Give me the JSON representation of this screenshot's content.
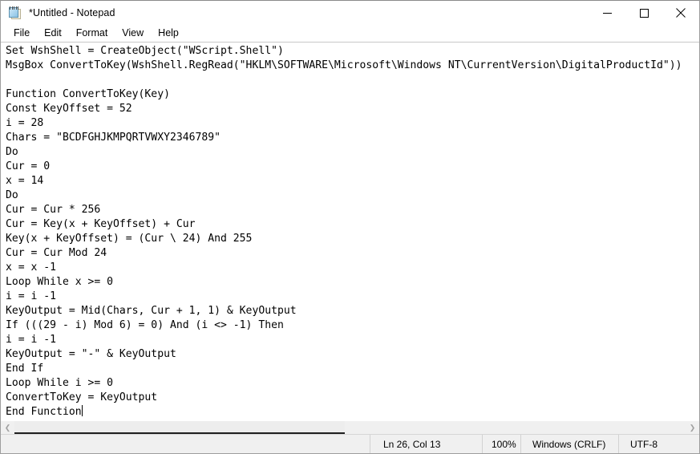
{
  "window": {
    "title": "*Untitled - Notepad",
    "icon": "notepad-icon",
    "controls": {
      "minimize": "minimize-icon",
      "maximize": "maximize-icon",
      "close": "close-icon"
    }
  },
  "menubar": {
    "items": [
      {
        "label": "File"
      },
      {
        "label": "Edit"
      },
      {
        "label": "Format"
      },
      {
        "label": "View"
      },
      {
        "label": "Help"
      }
    ]
  },
  "editor": {
    "lines": [
      "Set WshShell = CreateObject(\"WScript.Shell\")",
      "MsgBox ConvertToKey(WshShell.RegRead(\"HKLM\\SOFTWARE\\Microsoft\\Windows NT\\CurrentVersion\\DigitalProductId\"))",
      "",
      "Function ConvertToKey(Key)",
      "Const KeyOffset = 52",
      "i = 28",
      "Chars = \"BCDFGHJKMPQRTVWXY2346789\"",
      "Do",
      "Cur = 0",
      "x = 14",
      "Do",
      "Cur = Cur * 256",
      "Cur = Key(x + KeyOffset) + Cur",
      "Key(x + KeyOffset) = (Cur \\ 24) And 255",
      "Cur = Cur Mod 24",
      "x = x -1",
      "Loop While x >= 0",
      "i = i -1",
      "KeyOutput = Mid(Chars, Cur + 1, 1) & KeyOutput",
      "If (((29 - i) Mod 6) = 0) And (i <> -1) Then",
      "i = i -1",
      "KeyOutput = \"-\" & KeyOutput",
      "End If",
      "Loop While i >= 0",
      "ConvertToKey = KeyOutput",
      "End Function"
    ],
    "caret_line_index": 25
  },
  "hscrollbar": {
    "left_arrow": "chevron-left-icon",
    "right_arrow": "chevron-right-icon"
  },
  "statusbar": {
    "position": "Ln 26, Col 13",
    "zoom": "100%",
    "line_ending": "Windows (CRLF)",
    "encoding": "UTF-8"
  },
  "colors": {
    "window_bg": "#ffffff",
    "chrome_bg": "#f0f0f0",
    "text": "#000000",
    "border": "#9e9e9e"
  }
}
